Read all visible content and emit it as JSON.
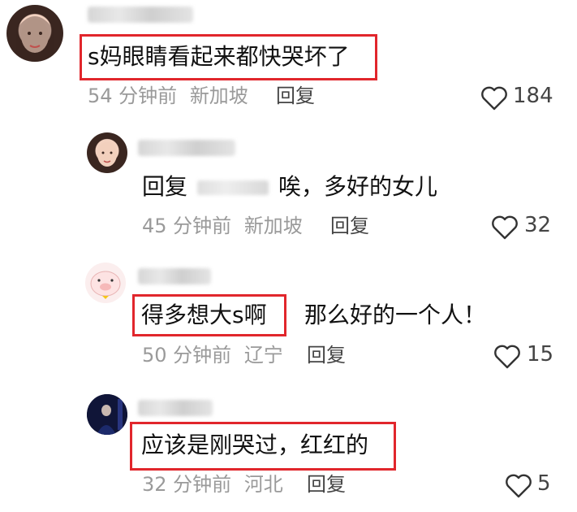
{
  "comments": [
    {
      "text": "s妈眼睛看起来都快哭坏了",
      "time": "54 分钟前",
      "location": "新加坡",
      "reply_label": "回复",
      "likes": "184"
    },
    {
      "prefix": "回复",
      "text": "唉，多好的女儿",
      "time": "45 分钟前",
      "location": "新加坡",
      "reply_label": "回复",
      "likes": "32"
    },
    {
      "text_highlight": "得多想大s啊",
      "text_rest": "那么好的一个人！",
      "time": "50 分钟前",
      "location": "辽宁",
      "reply_label": "回复",
      "likes": "15"
    },
    {
      "text": "应该是刚哭过，红红的",
      "time": "32 分钟前",
      "location": "河北",
      "reply_label": "回复",
      "likes": "5"
    }
  ],
  "colors": {
    "highlight_box": "#e1262c",
    "meta": "#9a9a9a"
  },
  "icons": {
    "like": "heart-outline-icon"
  }
}
